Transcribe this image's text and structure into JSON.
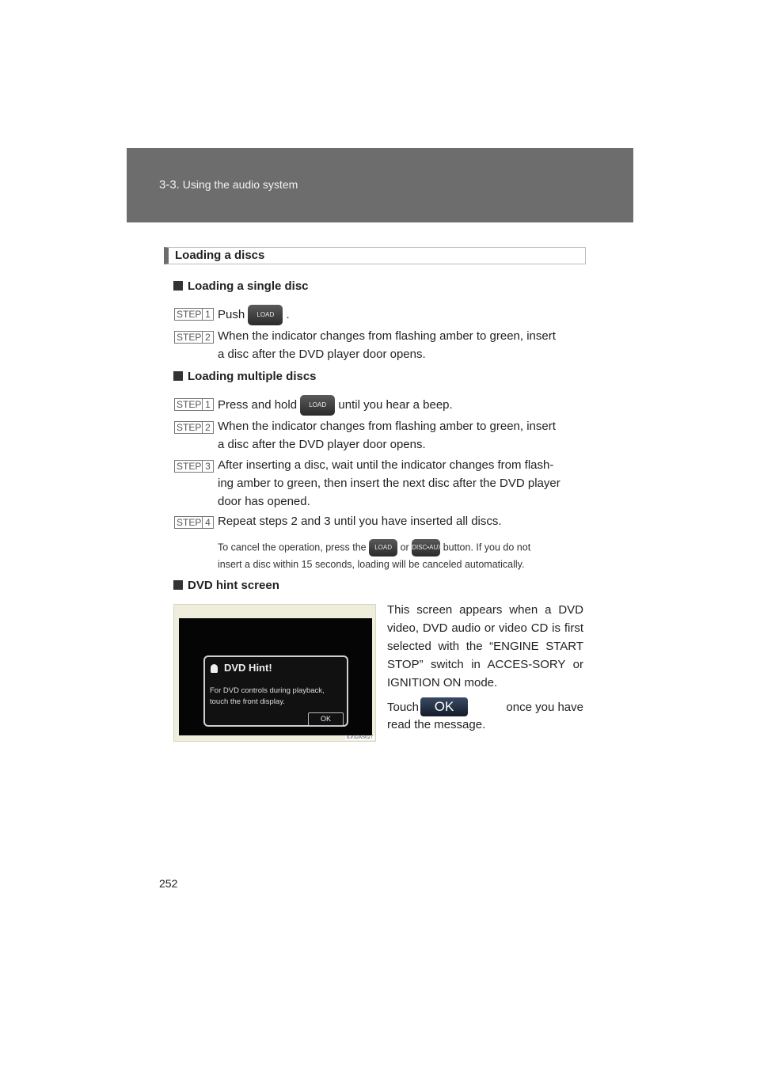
{
  "header": {
    "chapter": "3-3.",
    "section": "Using the audio system"
  },
  "page_number": "252",
  "heading": "Loading a discs",
  "single": {
    "title": "Loading a single disc",
    "steps": [
      {
        "word": "STEP",
        "num": "1",
        "pre": "Push",
        "button": "LOAD",
        "post": "."
      },
      {
        "word": "STEP",
        "num": "2",
        "line1": "When the indicator changes from flashing amber to green, insert",
        "line2": "a disc after the DVD player door opens."
      }
    ]
  },
  "multiple": {
    "title": "Loading multiple discs",
    "steps": [
      {
        "word": "STEP",
        "num": "1",
        "pre": "Press and hold",
        "button": "LOAD",
        "post": "until you hear a beep."
      },
      {
        "word": "STEP",
        "num": "2",
        "line1": "When the indicator changes from flashing amber to green, insert",
        "line2": "a disc after the DVD player door opens."
      },
      {
        "word": "STEP",
        "num": "3",
        "line1": "After inserting a disc, wait until the indicator changes from flash-",
        "line2": "ing amber to green, then insert the next disc after the DVD player",
        "line3": "door has opened."
      },
      {
        "word": "STEP",
        "num": "4",
        "line1": "Repeat steps 2 and 3 until you have inserted all discs."
      }
    ],
    "note": {
      "pre": "To cancel the operation, press the",
      "btn1": "LOAD",
      "mid": "or",
      "btn2": "DISC•AUX",
      "post": "button. If you do not",
      "line2": "insert a disc within 15 seconds, loading will be canceled automatically."
    }
  },
  "dvd_hint": {
    "title": "DVD hint screen",
    "para1": "This screen appears when a DVD video, DVD audio or video CD is first selected with the “ENGINE START STOP” switch in ACCES-SORY or IGNITION ON mode.",
    "para2_pre": "Touch",
    "ok_label": "OK",
    "para2_post": "once you have read the message.",
    "image": {
      "dialog_title": "DVD Hint!",
      "dialog_line1": "For DVD controls during playback,",
      "dialog_line2": "touch the front display.",
      "dialog_ok": "OK",
      "code": "ILV32AS027"
    }
  }
}
